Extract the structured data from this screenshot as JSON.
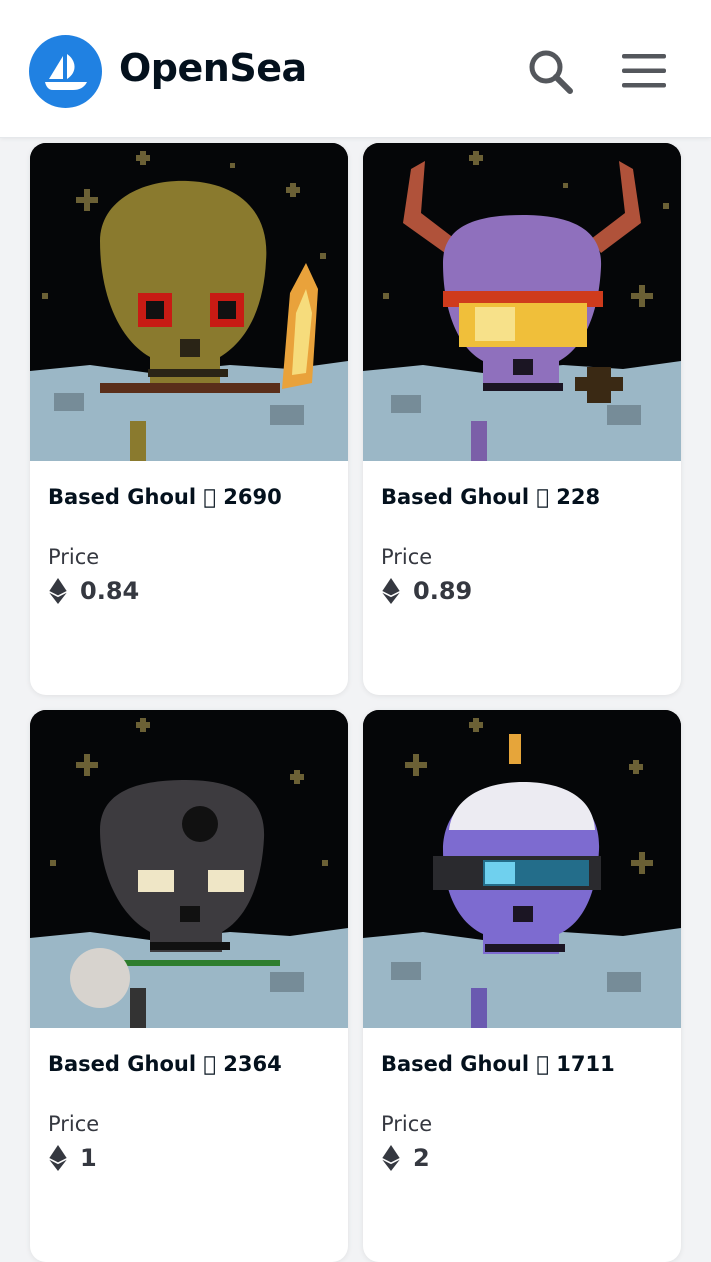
{
  "header": {
    "brand": "OpenSea",
    "logo_icon": "boat-icon",
    "search_icon": "search-icon",
    "menu_icon": "hamburger-menu-icon",
    "brand_color": "#2081e2"
  },
  "cards": [
    {
      "title": "Based Ghoul \u0000 2690",
      "price_label": "Price",
      "price": "0.84",
      "currency_icon": "ethereum-icon"
    },
    {
      "title": "Based Ghoul \u0000 228",
      "price_label": "Price",
      "price": "0.89",
      "currency_icon": "ethereum-icon"
    },
    {
      "title": "Based Ghoul \u0000 2364",
      "price_label": "Price",
      "price": "1",
      "currency_icon": "ethereum-icon"
    },
    {
      "title": "Based Ghoul \u0000 1711",
      "price_label": "Price",
      "price": "2",
      "currency_icon": "ethereum-icon"
    }
  ]
}
